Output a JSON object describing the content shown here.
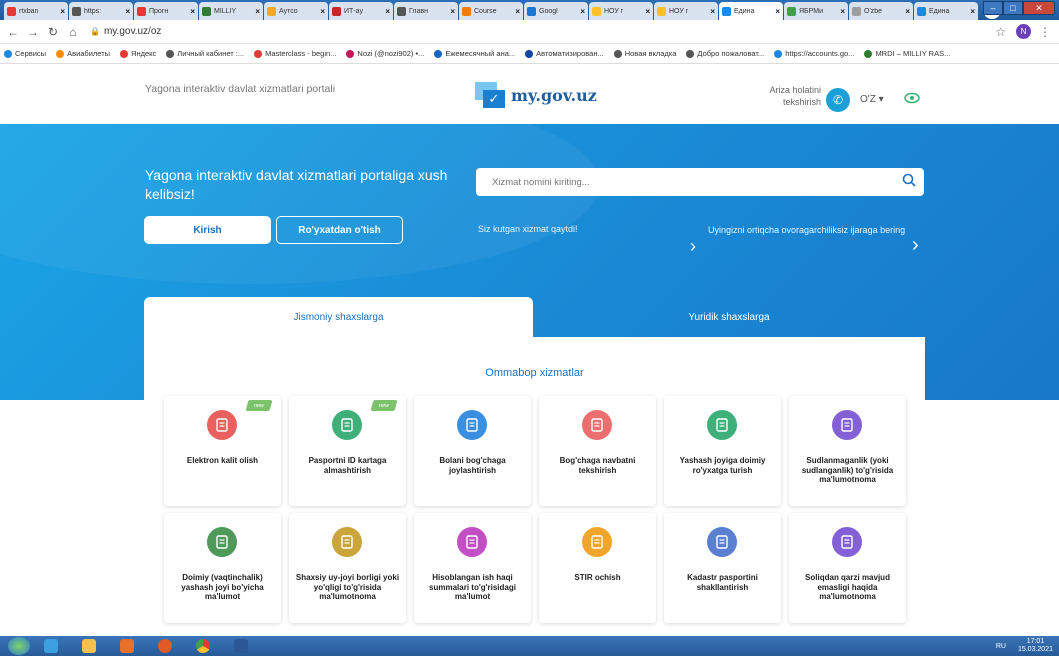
{
  "browser": {
    "tabs": [
      {
        "label": "rtxban",
        "color": "#e53935"
      },
      {
        "label": "https:",
        "color": "#555555"
      },
      {
        "label": "Прогн",
        "color": "#e53935"
      },
      {
        "label": "MILLIY",
        "color": "#2e7d32"
      },
      {
        "label": "Аутсо",
        "color": "#f9a825"
      },
      {
        "label": "ИТ-ау",
        "color": "#c62828"
      },
      {
        "label": "Главн",
        "color": "#555555"
      },
      {
        "label": "Course",
        "color": "#f57c00"
      },
      {
        "label": "Googl",
        "color": "#1976d2"
      },
      {
        "label": "НОУ г",
        "color": "#fbc02d"
      },
      {
        "label": "НОУ г",
        "color": "#fbc02d"
      },
      {
        "label": "Едина",
        "color": "#1e88e5"
      },
      {
        "label": "ЯБРМи",
        "color": "#43a047"
      },
      {
        "label": "O'zbe",
        "color": "#9e9e9e"
      },
      {
        "label": "Едина",
        "color": "#1e88e5"
      }
    ],
    "new_tab_label": "+",
    "url": "my.gov.uz/oz",
    "profile_initial": "N",
    "bookmarks": [
      {
        "label": "Сервисы",
        "color": "#1e88e5"
      },
      {
        "label": "Авиабилеты",
        "color": "#fb8c00"
      },
      {
        "label": "Яндекс",
        "color": "#e53935"
      },
      {
        "label": "Личный кабинет :...",
        "color": "#555555"
      },
      {
        "label": "Masterclass - begin...",
        "color": "#e53935"
      },
      {
        "label": "Nozi (@nozi902) •...",
        "color": "#c2185b"
      },
      {
        "label": "Ежемесячный ана...",
        "color": "#1565c0"
      },
      {
        "label": "Автоматизирован...",
        "color": "#0d47a1"
      },
      {
        "label": "Новая вкладка",
        "color": "#555555"
      },
      {
        "label": "Добро пожаловат...",
        "color": "#555555"
      },
      {
        "label": "https://accounts.go...",
        "color": "#1e88e5"
      },
      {
        "label": "MRDI – MILLIY RAS...",
        "color": "#2e7d32"
      }
    ]
  },
  "header": {
    "portal_name": "Yagona interaktiv davlat xizmatlari portali",
    "logo_text": "my.gov.uz",
    "status_check": "Ariza holatini tekshirish",
    "lang": "O'Z ▾"
  },
  "hero": {
    "welcome": "Yagona interaktiv davlat xizmatlari portaliga xush kelibsiz!",
    "login_label": "Kirish",
    "register_label": "Ro'yxatdan o'tish",
    "search_placeholder": "Xizmat nomini kiriting...",
    "promo1": "Siz kutgan xizmat qaytdi!",
    "promo2": "Uyingizni ortiqcha ovoragarchiliksiz ijaraga bering"
  },
  "tabs": {
    "individuals": "Jismoniy shaxslarga",
    "legal": "Yuridik shaxslarga"
  },
  "popular_title": "Ommabop xizmatlar",
  "badge_new": "new",
  "services": [
    {
      "label": "Elektron kalit olish",
      "color": "#e8615f",
      "icon": "key-icon",
      "new": true
    },
    {
      "label": "Pasportni ID kartaga almashtirish",
      "color": "#3fb07a",
      "icon": "id-card-icon",
      "new": true
    },
    {
      "label": "Bolani bog'chaga joylashtirish",
      "color": "#3a8fe0",
      "icon": "kindergarten-icon",
      "new": false
    },
    {
      "label": "Bog'chaga navbatni tekshirish",
      "color": "#ec6f6f",
      "icon": "queue-icon",
      "new": false
    },
    {
      "label": "Yashash joyiga doimiy ro'yxatga turish",
      "color": "#3fb07a",
      "icon": "residence-icon",
      "new": false
    },
    {
      "label": "Sudlanmaganlik (yoki sudlanganlik) to'g'risida ma'lumotnoma",
      "color": "#8360d6",
      "icon": "certificate-icon",
      "new": false
    },
    {
      "label": "Doimiy (vaqtinchalik) yashash joyi bo'yicha ma'lumot",
      "color": "#4f9a5a",
      "icon": "address-icon",
      "new": false
    },
    {
      "label": "Shaxsiy uy-joyi borligi yoki yo'qligi to'g'risida ma'lumotnoma",
      "color": "#c9a53a",
      "icon": "house-document-icon",
      "new": false
    },
    {
      "label": "Hisoblangan ish haqi summalari to'g'risidagi ma'lumot",
      "color": "#c34fc4",
      "icon": "salary-icon",
      "new": false
    },
    {
      "label": "STIR ochish",
      "color": "#f2a52b",
      "icon": "tax-id-icon",
      "new": false
    },
    {
      "label": "Kadastr pasportini shakllantirish",
      "color": "#5b7fd1",
      "icon": "cadastre-icon",
      "new": false
    },
    {
      "label": "Soliqdan qarzi mavjud emasligi haqida ma'lumotnoma",
      "color": "#8360d6",
      "icon": "tax-debt-icon",
      "new": false
    }
  ],
  "taskbar": {
    "lang": "RU",
    "time": "17:01",
    "date": "15.03.2021"
  }
}
